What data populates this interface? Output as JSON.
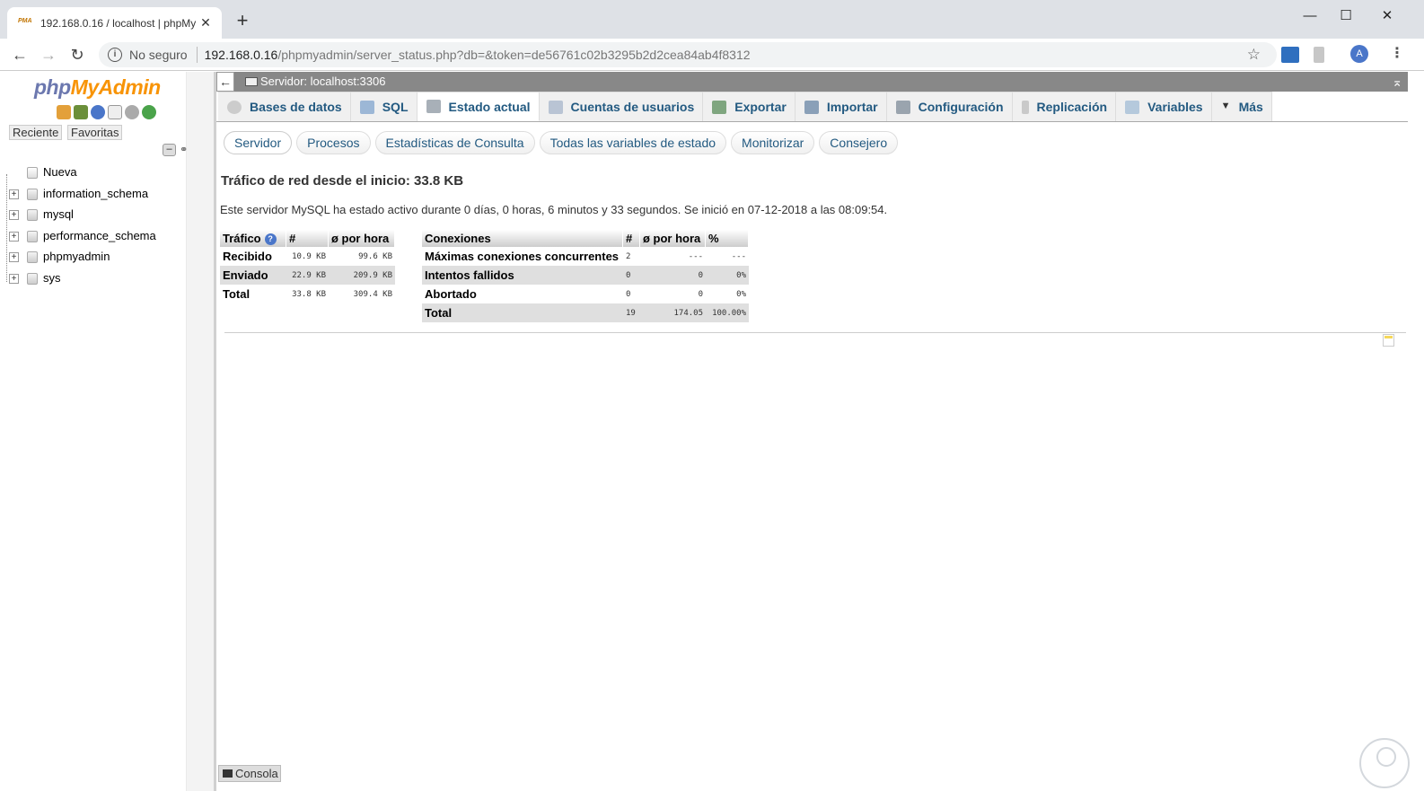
{
  "browser": {
    "tab_title": "192.168.0.16 / localhost | phpMy",
    "tab_favicon": "pma-favicon",
    "security_label": "No seguro",
    "url_host": "192.168.0.16",
    "url_path": "/phpmyadmin/server_status.php?db=&token=de56761c02b3295b2d2cea84ab4f8312",
    "profile_initial": "A"
  },
  "logo": {
    "php": "php",
    "myadmin": "MyAdmin"
  },
  "nav": {
    "recent_label": "Reciente",
    "favorites_label": "Favoritas",
    "new_label": "Nueva",
    "databases": [
      "information_schema",
      "mysql",
      "performance_schema",
      "phpmyadmin",
      "sys"
    ]
  },
  "server_bar": {
    "label": "Servidor: localhost:3306"
  },
  "menu_tabs": [
    {
      "label": "Bases de datos",
      "icon": "database-icon"
    },
    {
      "label": "SQL",
      "icon": "sql-icon"
    },
    {
      "label": "Estado actual",
      "icon": "status-icon",
      "active": true
    },
    {
      "label": "Cuentas de usuarios",
      "icon": "users-icon"
    },
    {
      "label": "Exportar",
      "icon": "export-icon"
    },
    {
      "label": "Importar",
      "icon": "import-icon"
    },
    {
      "label": "Configuración",
      "icon": "wrench-icon"
    },
    {
      "label": "Replicación",
      "icon": "replication-icon"
    },
    {
      "label": "Variables",
      "icon": "variables-icon"
    },
    {
      "label": "Más",
      "icon": "triangle-down-icon"
    }
  ],
  "sub_tabs": [
    "Servidor",
    "Procesos",
    "Estadísticas de Consulta",
    "Todas las variables de estado",
    "Monitorizar",
    "Consejero"
  ],
  "traffic_title": "Tráfico de red desde el inicio: 33.8 KB",
  "uptime_text": "Este servidor MySQL ha estado activo durante 0 días, 0 horas, 6 minutos y 33 segundos. Se inició en 07-12-2018 a las 08:09:54.",
  "traffic_table": {
    "headers": [
      "Tráfico",
      "#",
      "ø por hora"
    ],
    "rows": [
      [
        "Recibido",
        "10.9 KB",
        "99.6 KB"
      ],
      [
        "Enviado",
        "22.9 KB",
        "209.9 KB"
      ],
      [
        "Total",
        "33.8 KB",
        "309.4 KB"
      ]
    ]
  },
  "connections_table": {
    "headers": [
      "Conexiones",
      "#",
      "ø por hora",
      "%"
    ],
    "rows": [
      [
        "Máximas conexiones concurrentes",
        "2",
        "---",
        "---"
      ],
      [
        "Intentos fallidos",
        "0",
        "0",
        "0%"
      ],
      [
        "Abortado",
        "0",
        "0",
        "0%"
      ],
      [
        "Total",
        "19",
        "174.05",
        "100.00%"
      ]
    ]
  },
  "console_label": "Consola",
  "colors": {
    "link": "#235a81",
    "server_bar": "#888888",
    "logo_php": "#6c78af",
    "logo_myadmin": "#f89406"
  }
}
